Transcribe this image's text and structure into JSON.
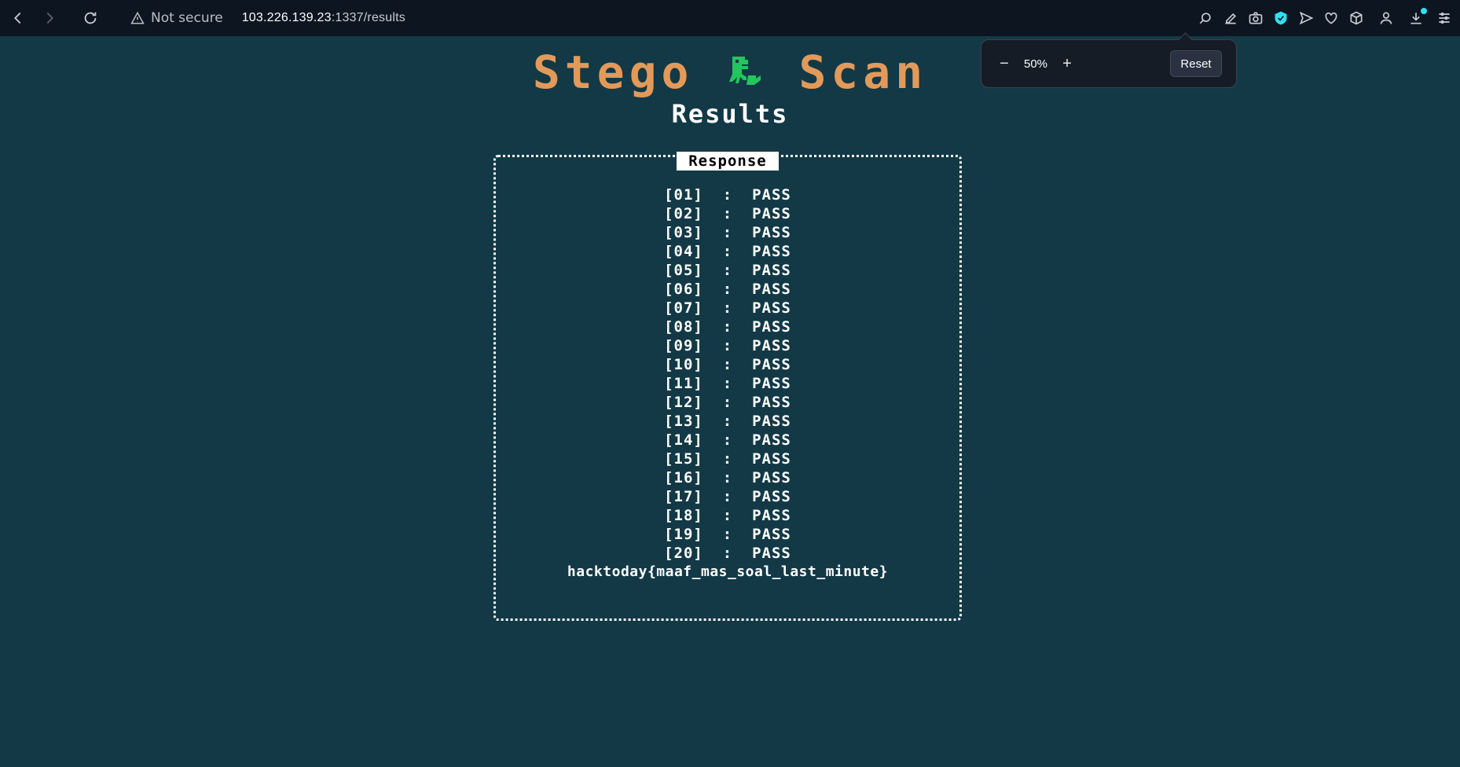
{
  "browser": {
    "security_label": "Not secure",
    "url_host": "103.226.139.23",
    "url_rest": ":1337/results",
    "zoom": {
      "value": "50%",
      "minus_label": "−",
      "plus_label": "+",
      "reset_label": "Reset"
    }
  },
  "page": {
    "title_left": "Stego",
    "title_right": "Scan",
    "subtitle": "Results",
    "box_label": "Response",
    "results": [
      {
        "id": "[01]",
        "status": "PASS"
      },
      {
        "id": "[02]",
        "status": "PASS"
      },
      {
        "id": "[03]",
        "status": "PASS"
      },
      {
        "id": "[04]",
        "status": "PASS"
      },
      {
        "id": "[05]",
        "status": "PASS"
      },
      {
        "id": "[06]",
        "status": "PASS"
      },
      {
        "id": "[07]",
        "status": "PASS"
      },
      {
        "id": "[08]",
        "status": "PASS"
      },
      {
        "id": "[09]",
        "status": "PASS"
      },
      {
        "id": "[10]",
        "status": "PASS"
      },
      {
        "id": "[11]",
        "status": "PASS"
      },
      {
        "id": "[12]",
        "status": "PASS"
      },
      {
        "id": "[13]",
        "status": "PASS"
      },
      {
        "id": "[14]",
        "status": "PASS"
      },
      {
        "id": "[15]",
        "status": "PASS"
      },
      {
        "id": "[16]",
        "status": "PASS"
      },
      {
        "id": "[17]",
        "status": "PASS"
      },
      {
        "id": "[18]",
        "status": "PASS"
      },
      {
        "id": "[19]",
        "status": "PASS"
      },
      {
        "id": "[20]",
        "status": "PASS"
      }
    ],
    "separator": ":",
    "flag": "hacktoday{maaf_mas_soal_last_minute}"
  },
  "colors": {
    "background": "#133946",
    "title": "#e29a5a",
    "dino": "#22c55e",
    "toolbar": "#0d1620",
    "badge": "#31e0f0"
  },
  "icons": [
    "back-icon",
    "forward-icon",
    "reload-icon",
    "warning-icon",
    "zoom-icon",
    "edit-icon",
    "camera-icon",
    "shield-icon",
    "send-icon",
    "heart-icon",
    "cube-icon",
    "profile-icon",
    "download-icon",
    "menu-icon",
    "dinosaur-icon"
  ]
}
